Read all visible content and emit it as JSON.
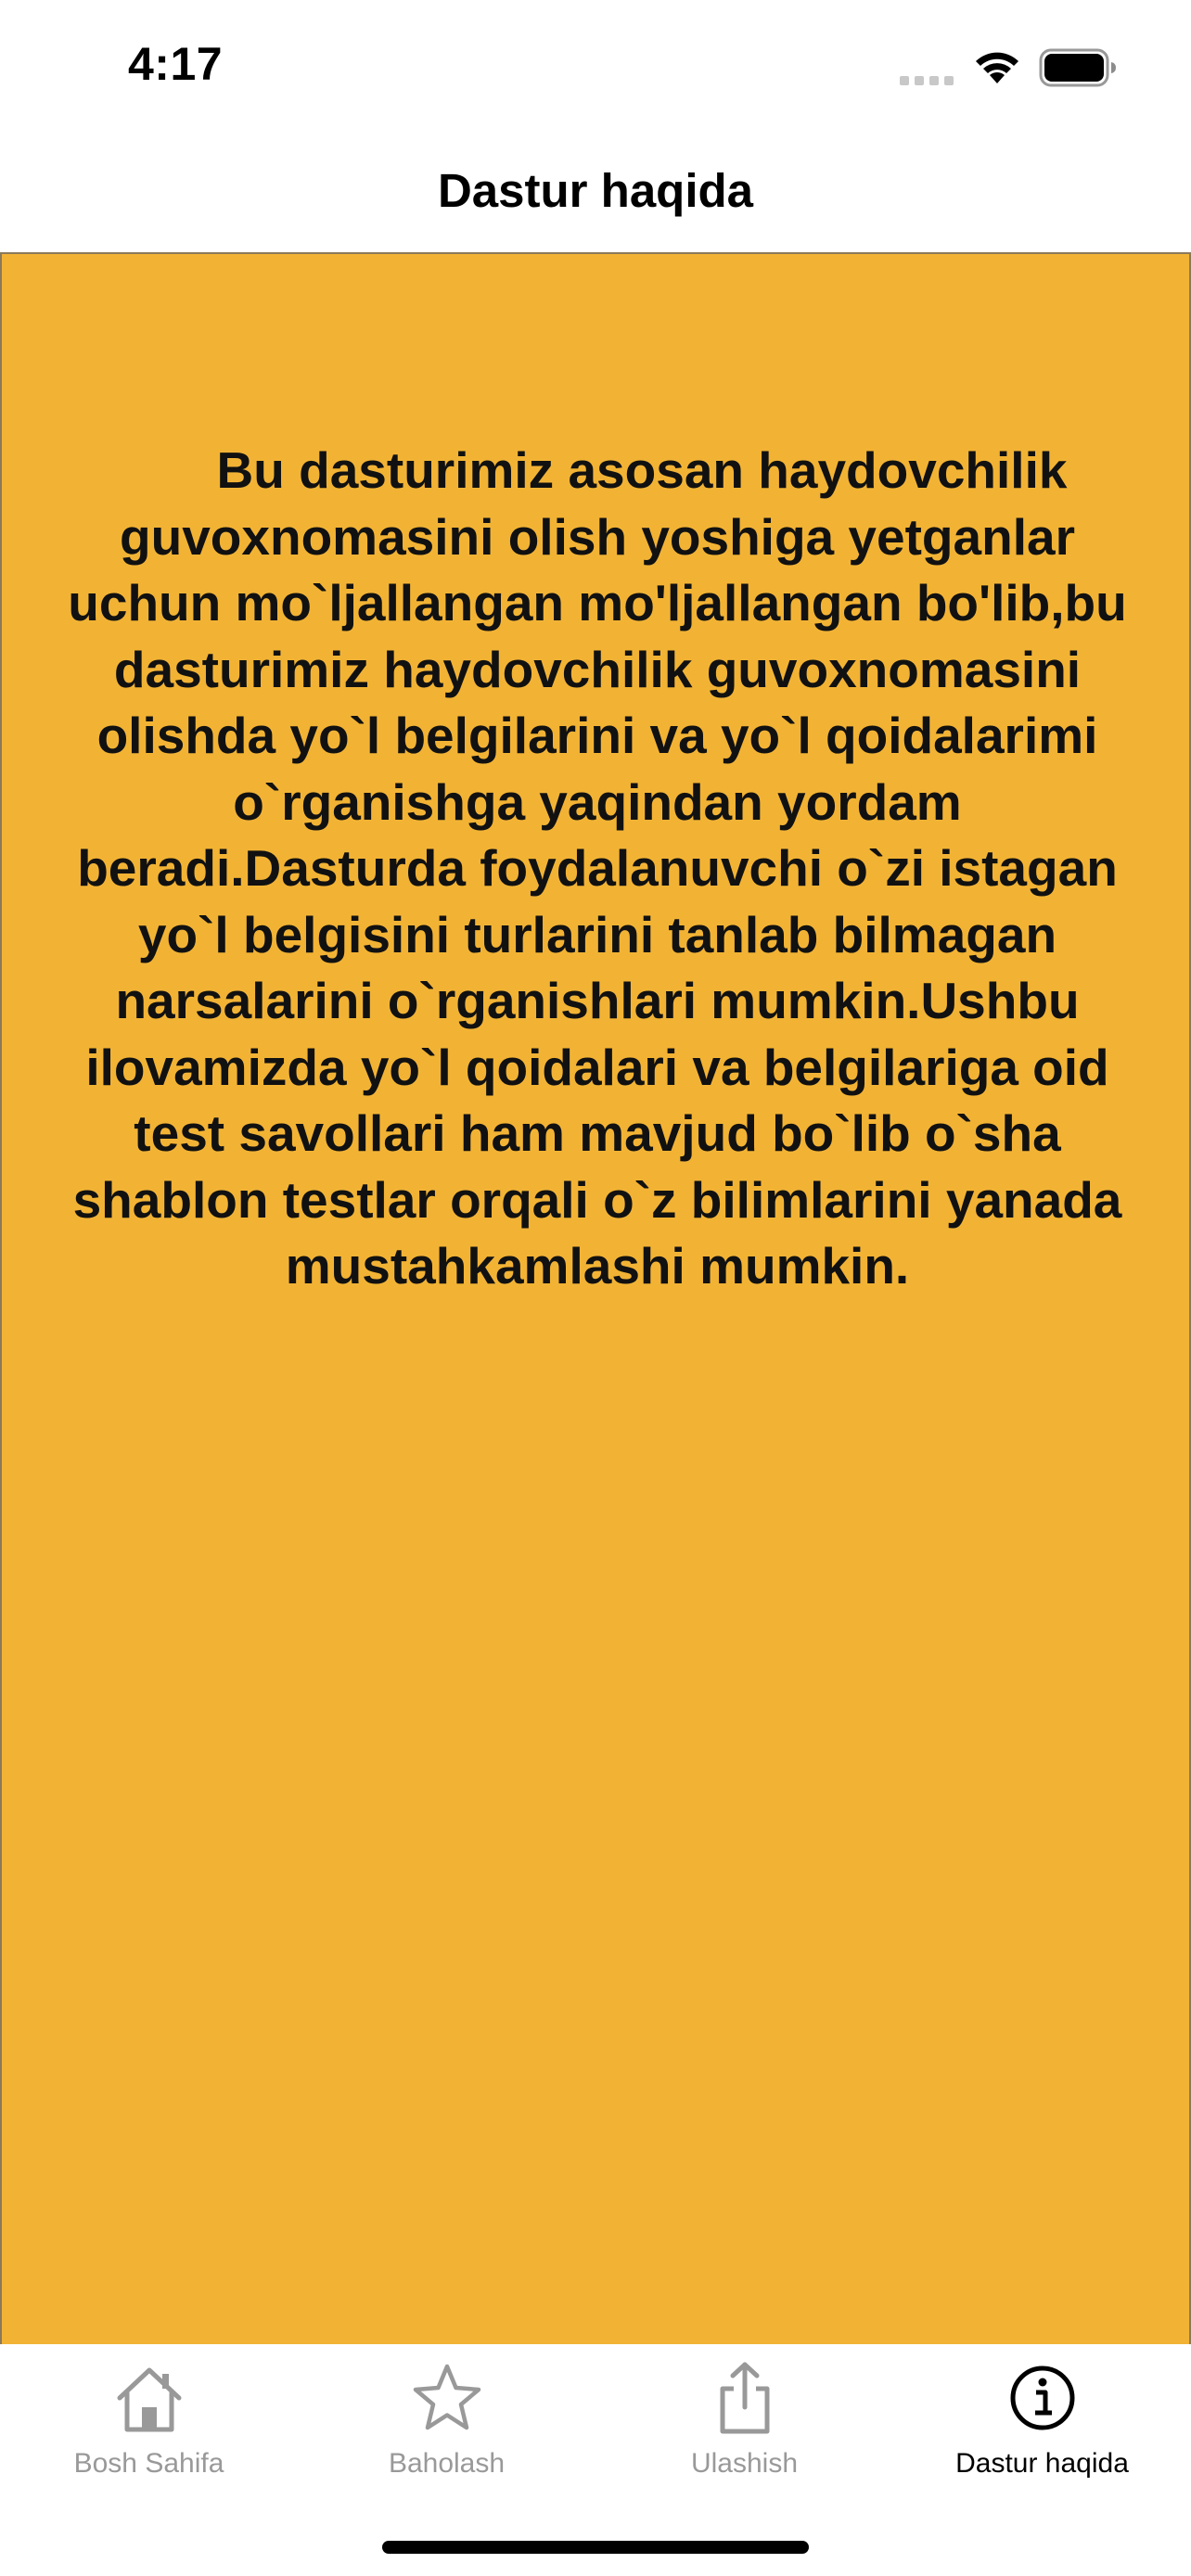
{
  "status_bar": {
    "time": "4:17"
  },
  "nav": {
    "title": "Dastur haqida"
  },
  "content": {
    "background_color": "#f2b335",
    "text": "Bu dasturimiz asosan haydovchilik guvoxnomasini olish yoshiga yetganlar uchun mo`ljallangan mo'ljallangan bo'lib,bu dasturimiz haydovchilik guvoxnomasini olishda yo`l belgilarini va yo`l qoidalarimi o`rganishga yaqindan yordam beradi.Dasturda foydalanuvchi o`zi istagan yo`l belgisini turlarini tanlab bilmagan narsalarini o`rganishlari mumkin.Ushbu ilovamizda yo`l qoidalari va belgilariga oid test savollari ham mavjud bo`lib o`sha shablon testlar orqali o`z bilimlarini yanada mustahkamlashi mumkin."
  },
  "tab_bar": {
    "items": [
      {
        "label": "Bosh Sahifa",
        "icon": "house-icon",
        "active": false
      },
      {
        "label": "Baholash",
        "icon": "star-icon",
        "active": false
      },
      {
        "label": "Ulashish",
        "icon": "share-icon",
        "active": false
      },
      {
        "label": "Dastur haqida",
        "icon": "info-icon",
        "active": true
      }
    ],
    "active_color": "#000000",
    "inactive_color": "#999999"
  }
}
